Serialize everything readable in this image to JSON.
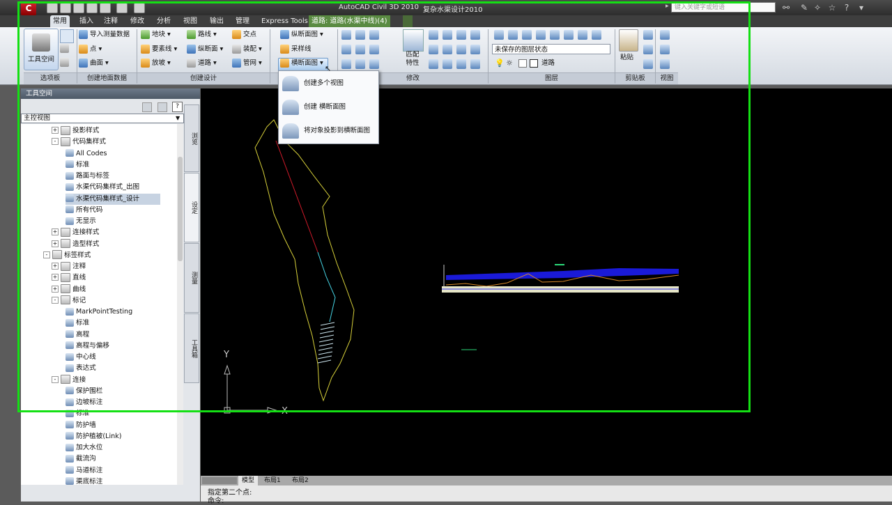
{
  "titlebar": {
    "app_title": "AutoCAD Civil 3D 2010",
    "document_title": "复杂水渠设计2010",
    "search_placeholder": "键入关键字或短语",
    "logo_text": "C"
  },
  "ribbon_tabs": [
    "常用",
    "插入",
    "注释",
    "修改",
    "分析",
    "视图",
    "输出",
    "管理",
    "Express Tools"
  ],
  "ribbon_context_tab": "道路: 道路(水渠中线)(4)",
  "ribbon": {
    "toolspace_label": "工具空间",
    "ground_data": [
      "导入测量数据",
      "点",
      "曲面"
    ],
    "create_design_col1": [
      "地块",
      "要素线",
      "放坡"
    ],
    "create_design_col2": [
      "路线",
      "纵断面",
      "道路"
    ],
    "create_design_col3": [
      "交点",
      "装配",
      "管网"
    ],
    "profile_section": [
      "纵断面图",
      "采样线",
      "横断面图"
    ],
    "match_props": "匹配\n特性",
    "layer_state": "未保存的图层状态",
    "layer_current": "道路",
    "paste_label": "粘贴",
    "panel_titles": [
      "选项板",
      "创建地面数据",
      "创建设计",
      "修改",
      "图层",
      "剪贴板",
      "视图"
    ]
  },
  "dropdown": {
    "items": [
      "创建多个视图",
      "创建 横断面图",
      "将对象投影到横断面图"
    ]
  },
  "palette": {
    "title": "工具空间",
    "view_select": "主控视图",
    "side_tabs": [
      "浏览",
      "设定",
      "测量",
      "工具箱"
    ],
    "tree": [
      {
        "label": "投影样式",
        "level": 2,
        "exp": "+",
        "icon": "fold"
      },
      {
        "label": "代码集样式",
        "level": 2,
        "exp": "-",
        "icon": "fold"
      },
      {
        "label": "All Codes",
        "level": 3,
        "exp": "",
        "icon": "node"
      },
      {
        "label": "标准",
        "level": 3,
        "exp": "",
        "icon": "node"
      },
      {
        "label": "路面与标签",
        "level": 3,
        "exp": "",
        "icon": "node"
      },
      {
        "label": "水渠代码集样式_出图",
        "level": 3,
        "exp": "",
        "icon": "node"
      },
      {
        "label": "水渠代码集样式_设计",
        "level": 3,
        "exp": "",
        "icon": "node",
        "selected": true
      },
      {
        "label": "所有代码",
        "level": 3,
        "exp": "",
        "icon": "node"
      },
      {
        "label": "无显示",
        "level": 3,
        "exp": "",
        "icon": "node"
      },
      {
        "label": "连接样式",
        "level": 2,
        "exp": "+",
        "icon": "fold"
      },
      {
        "label": "造型样式",
        "level": 2,
        "exp": "+",
        "icon": "fold"
      },
      {
        "label": "标签样式",
        "level": 1,
        "exp": "-",
        "icon": "fold"
      },
      {
        "label": "注释",
        "level": 2,
        "exp": "+",
        "icon": "fold"
      },
      {
        "label": "直线",
        "level": 2,
        "exp": "+",
        "icon": "fold"
      },
      {
        "label": "曲线",
        "level": 2,
        "exp": "+",
        "icon": "fold"
      },
      {
        "label": "标记",
        "level": 2,
        "exp": "-",
        "icon": "fold"
      },
      {
        "label": "MarkPointTesting",
        "level": 3,
        "exp": "",
        "icon": "node"
      },
      {
        "label": "标准",
        "level": 3,
        "exp": "",
        "icon": "node"
      },
      {
        "label": "高程",
        "level": 3,
        "exp": "",
        "icon": "node"
      },
      {
        "label": "高程与偏移",
        "level": 3,
        "exp": "",
        "icon": "node"
      },
      {
        "label": "中心线",
        "level": 3,
        "exp": "",
        "icon": "node"
      },
      {
        "label": "表达式",
        "level": 3,
        "exp": "",
        "icon": "node"
      },
      {
        "label": "连接",
        "level": 2,
        "exp": "-",
        "icon": "fold"
      },
      {
        "label": "保护围栏",
        "level": 3,
        "exp": "",
        "icon": "node"
      },
      {
        "label": "边坡标注",
        "level": 3,
        "exp": "",
        "icon": "node"
      },
      {
        "label": "标准",
        "level": 3,
        "exp": "",
        "icon": "node"
      },
      {
        "label": "防护墙",
        "level": 3,
        "exp": "",
        "icon": "node"
      },
      {
        "label": "防护植被(Link)",
        "level": 3,
        "exp": "",
        "icon": "node"
      },
      {
        "label": "加大水位",
        "level": 3,
        "exp": "",
        "icon": "node"
      },
      {
        "label": "截流沟",
        "level": 3,
        "exp": "",
        "icon": "node"
      },
      {
        "label": "马道标注",
        "level": 3,
        "exp": "",
        "icon": "node"
      },
      {
        "label": "渠底标注",
        "level": 3,
        "exp": "",
        "icon": "node"
      }
    ]
  },
  "drawing": {
    "ucs_y": "Y",
    "ucs_x": "X"
  },
  "layout_tabs": [
    "模型",
    "布局1",
    "布局2"
  ],
  "command_line": [
    "指定第二个点:",
    "命令:"
  ],
  "colors": {
    "capture_frame": "#14e014",
    "alignment": "#d9d23a",
    "section_band": "#1a1ad8"
  }
}
